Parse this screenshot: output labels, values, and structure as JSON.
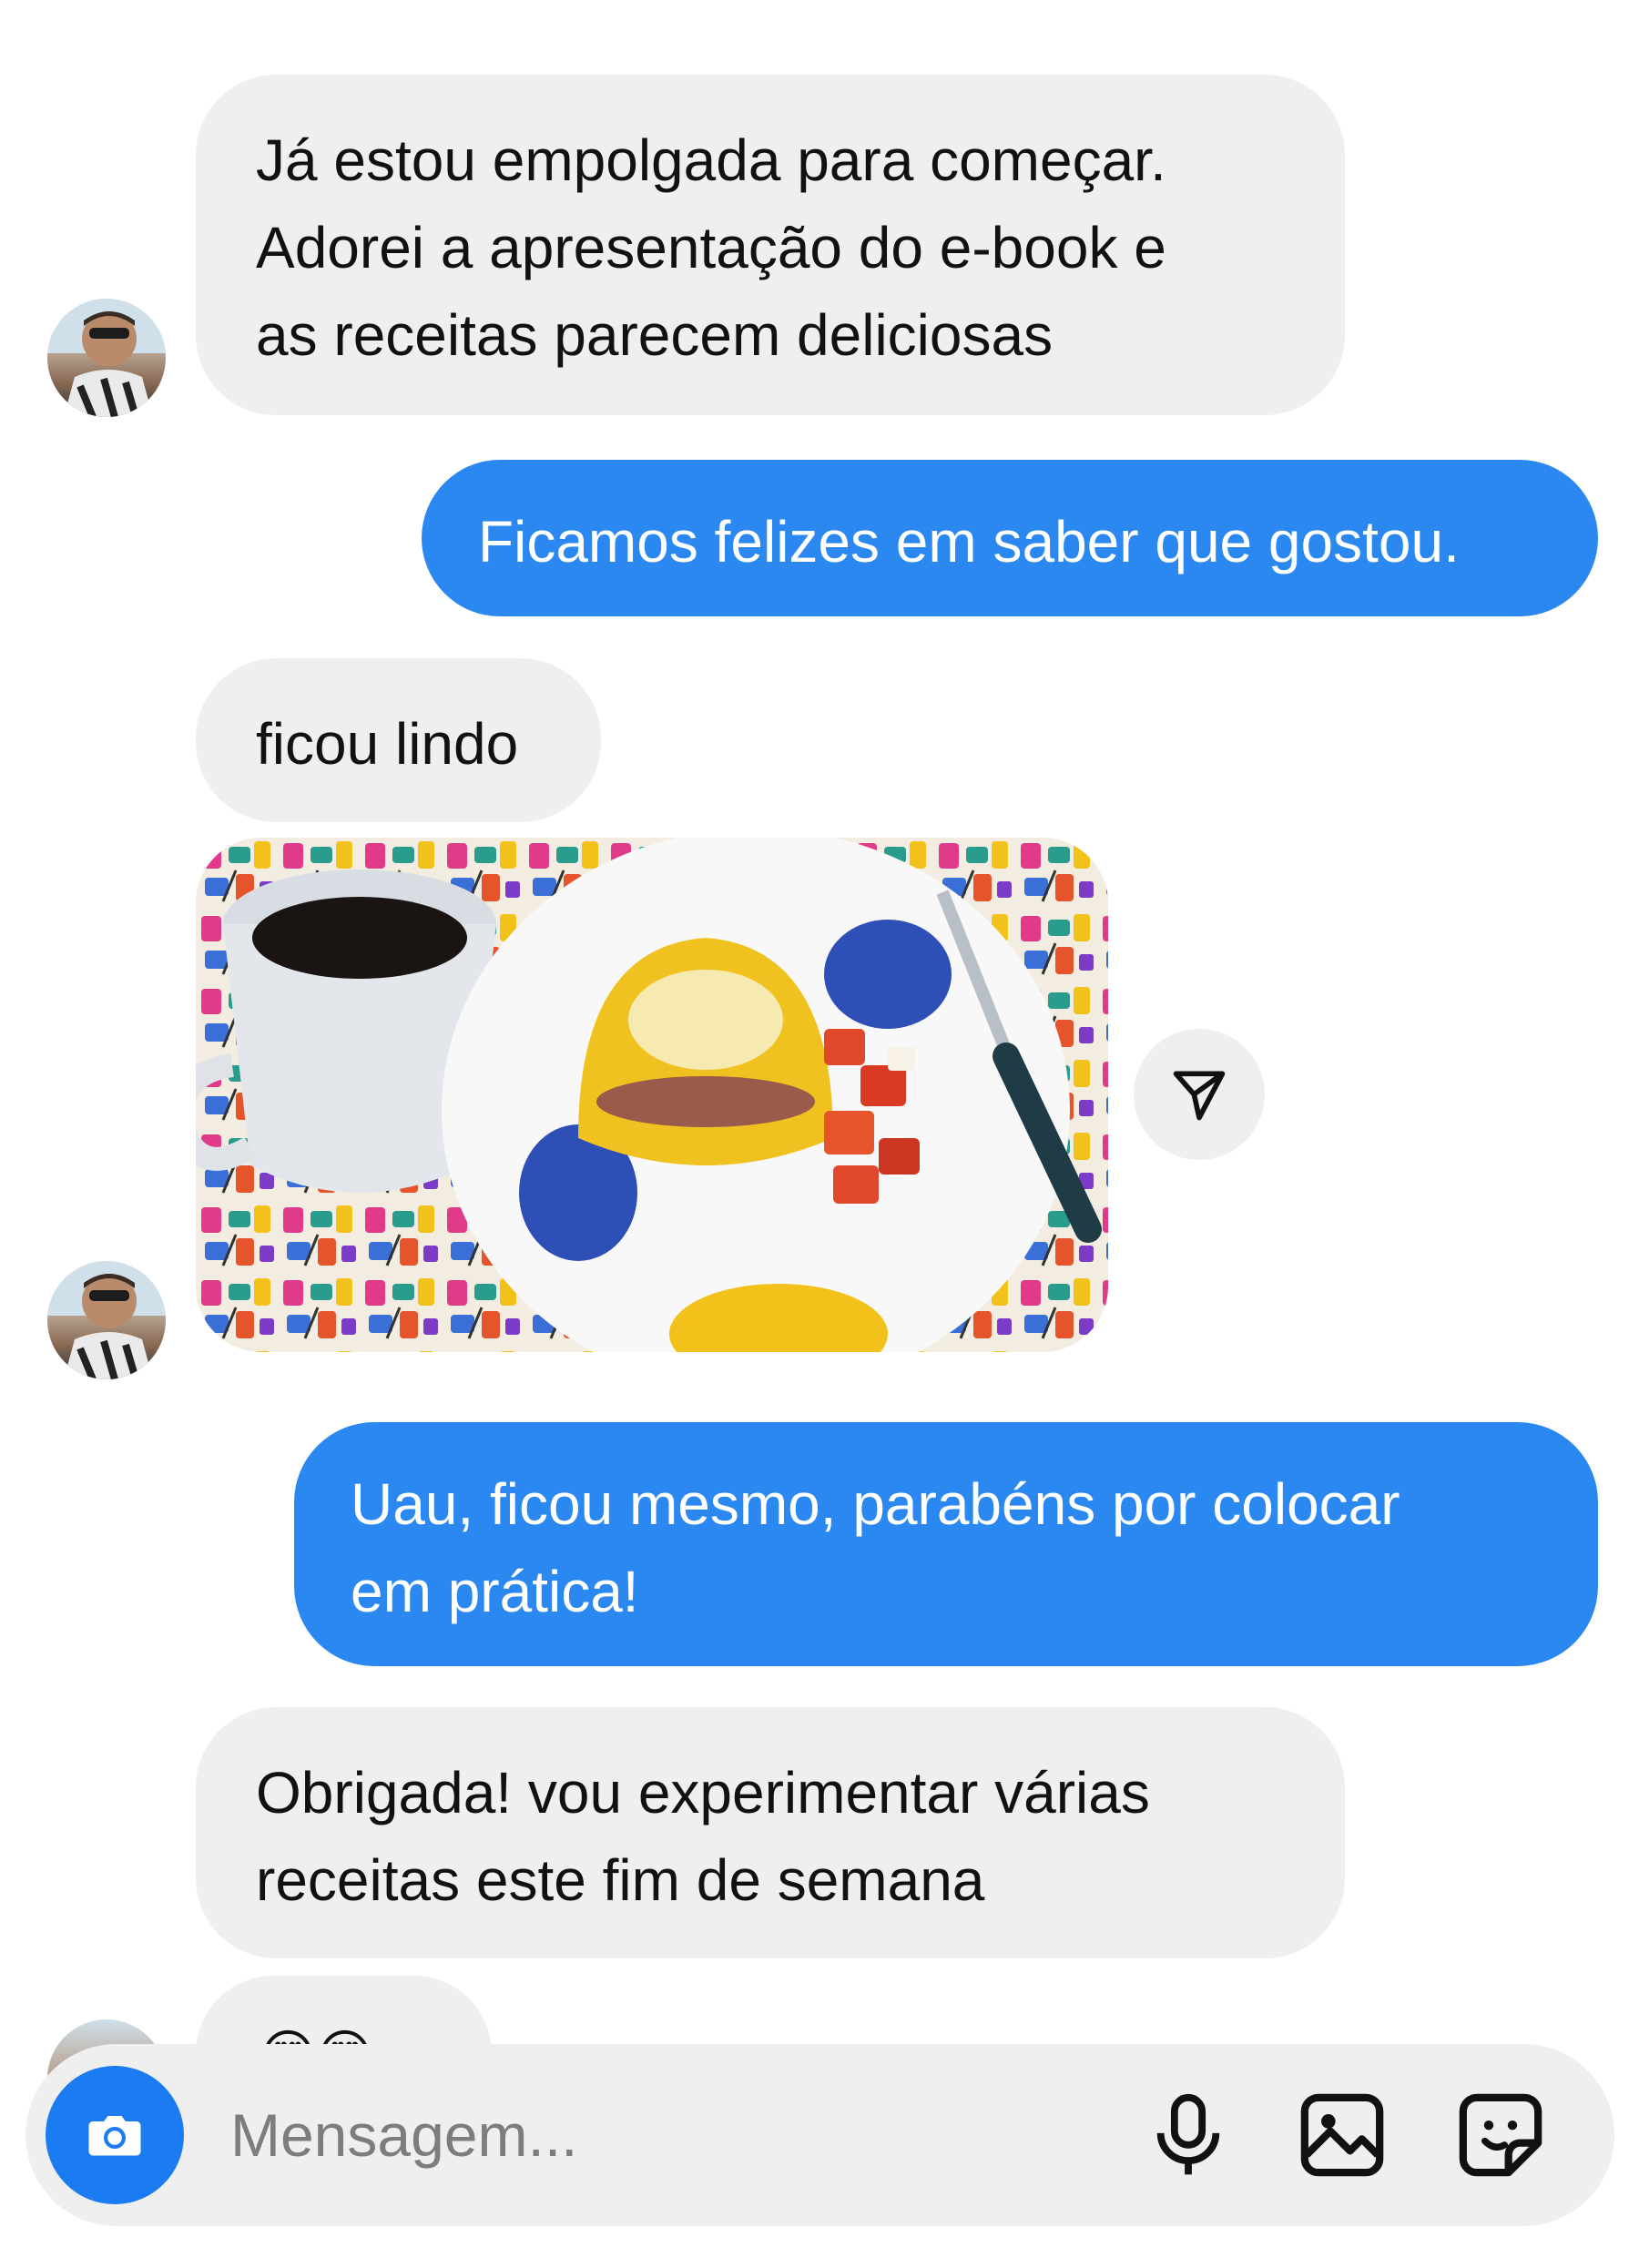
{
  "messages": [
    {
      "from": "them",
      "text": "Já estou empolgada para começar.\nAdorei a apresentação do e-book e\nas receitas parecem deliciosas"
    },
    {
      "from": "me",
      "text": "Ficamos felizes em saber que gostou."
    },
    {
      "from": "them",
      "text": "ficou lindo"
    },
    {
      "from": "them",
      "type": "photo",
      "text": ""
    },
    {
      "from": "me",
      "text": "Uau, ficou mesmo, parabéns por colocar\nem prática!"
    },
    {
      "from": "them",
      "text": "Obrigada! vou experimentar várias\nreceitas este fim de semana"
    },
    {
      "from": "them",
      "text": "😍😍"
    }
  ],
  "composer": {
    "placeholder": "Mensagem...",
    "icons": [
      "camera-icon",
      "microphone-icon",
      "gallery-icon",
      "sticker-icon"
    ]
  },
  "colors": {
    "outgoing_bubble": "#2a88f0",
    "incoming_bubble": "#efefef",
    "camera_button": "#1a7cf0"
  }
}
